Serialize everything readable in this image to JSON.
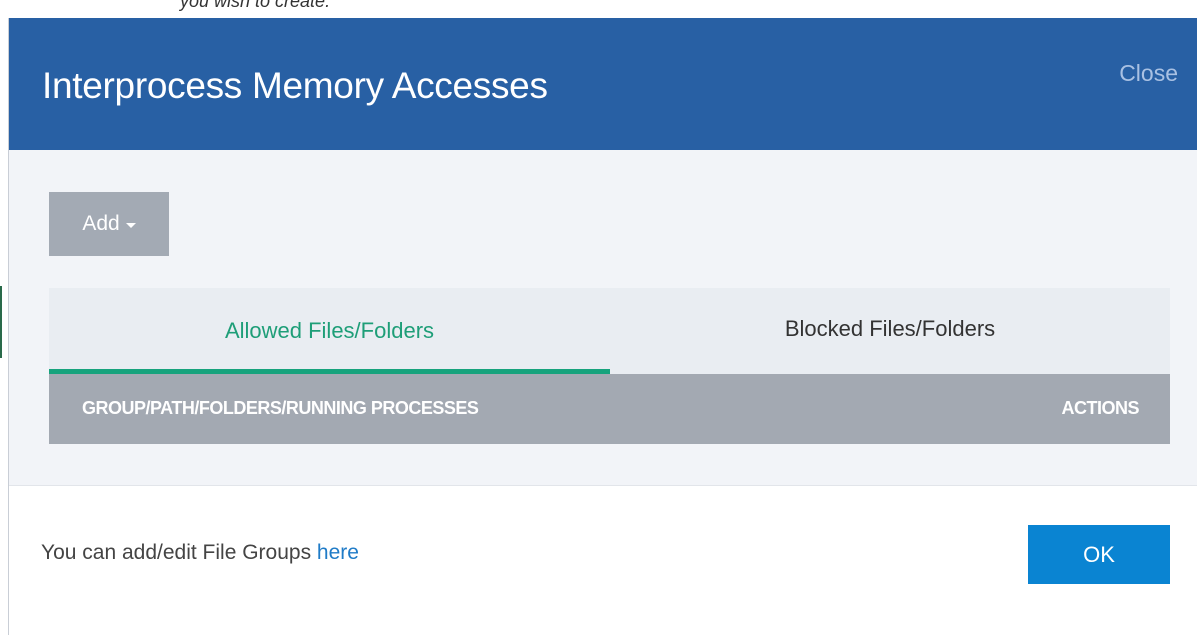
{
  "background": {
    "partial_text": "you wish to create."
  },
  "dialog": {
    "title": "Interprocess Memory Accesses",
    "close_label": "Close"
  },
  "toolbar": {
    "add_label": "Add",
    "add_icon": "caret-down-icon"
  },
  "tabs": [
    {
      "label": "Allowed Files/Folders",
      "active": true
    },
    {
      "label": "Blocked Files/Folders",
      "active": false
    }
  ],
  "table": {
    "columns": [
      "GROUP/PATH/FOLDERS/RUNNING PROCESSES",
      "ACTIONS"
    ],
    "rows": []
  },
  "footer": {
    "text": "You can add/edit File Groups",
    "link_label": "here",
    "ok_label": "OK"
  },
  "colors": {
    "header_bg": "#2860a4",
    "active_tab": "#17a37d",
    "ok_button": "#0a84d2",
    "link": "#1f7bc7"
  }
}
